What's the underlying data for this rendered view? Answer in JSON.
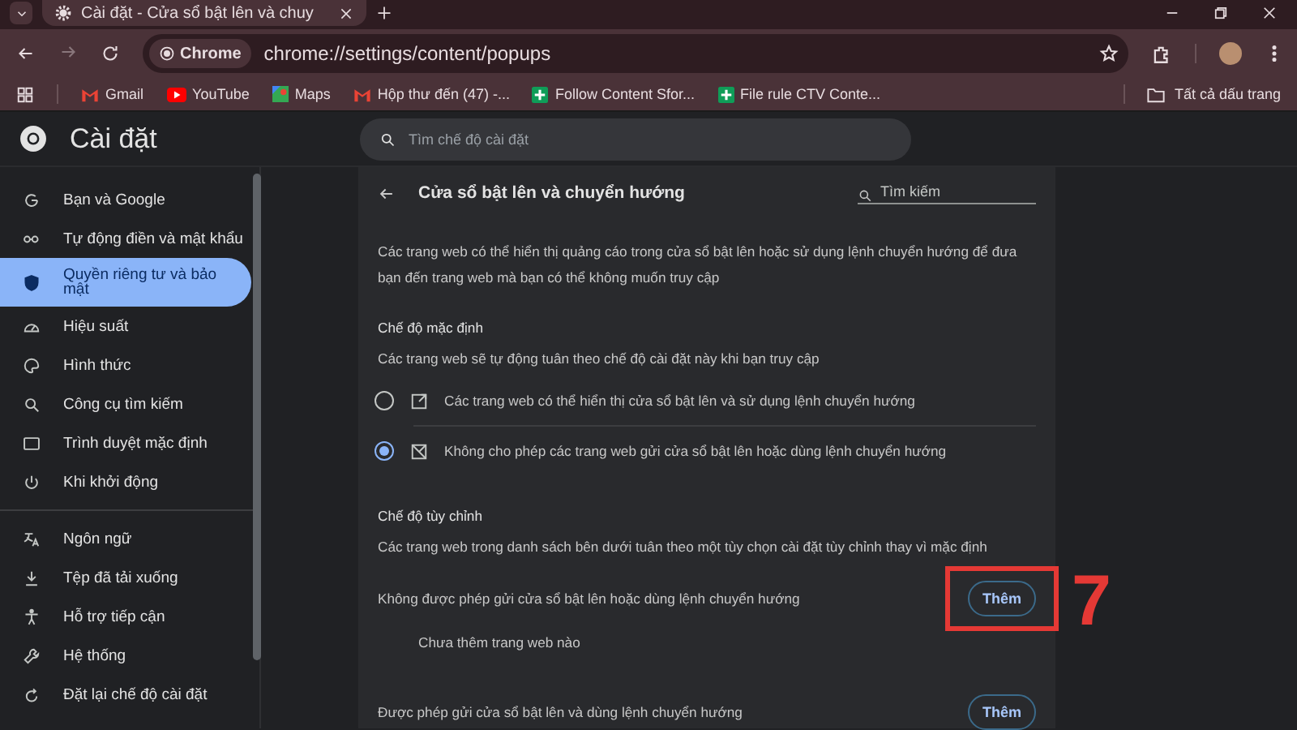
{
  "browser": {
    "tabs": [
      {
        "title": "Cài đặt - Cửa sổ bật lên và chuy",
        "selected": true
      }
    ],
    "address": {
      "chip": "Chrome",
      "url": "chrome://settings/content/popups"
    },
    "bookmarks": [
      {
        "label": "Gmail",
        "kind": "mail"
      },
      {
        "label": "YouTube",
        "kind": "video"
      },
      {
        "label": "Maps",
        "kind": "map"
      },
      {
        "label": "Hộp thư đến (47) -...",
        "kind": "mail"
      },
      {
        "label": "Follow Content Sfor...",
        "kind": "sheet"
      },
      {
        "label": "File rule CTV Conte...",
        "kind": "sheet"
      }
    ],
    "all_bookmarks": "Tất cả dấu trang"
  },
  "settings_header": {
    "title": "Cài đặt",
    "search": {
      "placeholder": "Tìm chế độ cài đặt"
    }
  },
  "sidebar": {
    "groups": [
      [
        {
          "label": "Bạn và Google",
          "selected": false
        },
        {
          "label": "Tự động điền và mật khẩu",
          "selected": false
        },
        {
          "label": "Quyền riêng tư và bảo mật",
          "selected": true
        },
        {
          "label": "Hiệu suất",
          "selected": false
        },
        {
          "label": "Hình thức",
          "selected": false
        },
        {
          "label": "Công cụ tìm kiếm",
          "selected": false
        },
        {
          "label": "Trình duyệt mặc định",
          "selected": false
        },
        {
          "label": "Khi khởi động",
          "selected": false
        }
      ],
      [
        {
          "label": "Ngôn ngữ",
          "selected": false
        },
        {
          "label": "Tệp đã tải xuống",
          "selected": false
        },
        {
          "label": "Hỗ trợ tiếp cận",
          "selected": false
        },
        {
          "label": "Hệ thống",
          "selected": false
        },
        {
          "label": "Đặt lại chế độ cài đặt",
          "selected": false
        }
      ]
    ]
  },
  "page": {
    "title": "Cửa sổ bật lên và chuyển hướng",
    "search": {
      "placeholder": "Tìm kiếm"
    },
    "description": "Các trang web có thể hiển thị quảng cáo trong cửa sổ bật lên hoặc sử dụng lệnh chuyển hướng để đưa bạn đến trang web mà bạn có thể không muốn truy cập",
    "default_mode": {
      "heading": "Chế độ mặc định",
      "subtext": "Các trang web sẽ tự động tuân theo chế độ cài đặt này khi bạn truy cập",
      "options": [
        {
          "label": "Các trang web có thể hiển thị cửa sổ bật lên và sử dụng lệnh chuyển hướng",
          "selected": false
        },
        {
          "label": "Không cho phép các trang web gửi cửa sổ bật lên hoặc dùng lệnh chuyển hướng",
          "selected": true
        }
      ]
    },
    "custom_mode": {
      "heading": "Chế độ tùy chỉnh",
      "subtext": "Các trang web trong danh sách bên dưới tuân theo một tùy chọn cài đặt tùy chỉnh thay vì mặc định",
      "lists": [
        {
          "label": "Không được phép gửi cửa sổ bật lên hoặc dùng lệnh chuyển hướng",
          "button": "Thêm",
          "empty": "Chưa thêm trang web nào"
        },
        {
          "label": "Được phép gửi cửa sổ bật lên và dùng lệnh chuyển hướng",
          "button": "Thêm"
        }
      ]
    }
  },
  "annotation": {
    "label": "7"
  }
}
